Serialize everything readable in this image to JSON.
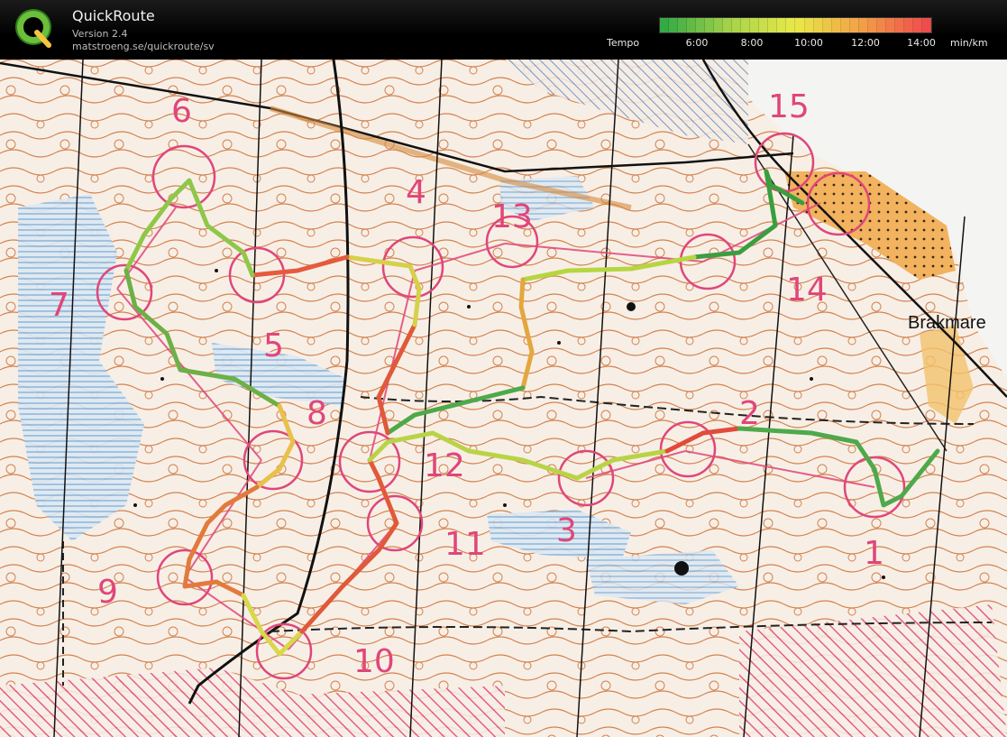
{
  "header": {
    "app_name": "QuickRoute",
    "version": "Version 2.4",
    "url": "matstroeng.se/quickroute/sv",
    "logo_letter": "Q"
  },
  "legend": {
    "title": "Tempo",
    "ticks": [
      "6:00",
      "8:00",
      "10:00",
      "12:00",
      "14:00"
    ],
    "unit": "min/km",
    "gradient_colors": [
      "#33aa44",
      "#a6d24a",
      "#e9e94a",
      "#f2a047",
      "#ee4c4c"
    ]
  },
  "map": {
    "place_label": "Brakmare",
    "control_numbers": [
      "1",
      "2",
      "3",
      "4",
      "5",
      "6",
      "7",
      "8",
      "9",
      "10",
      "11",
      "12",
      "13",
      "14",
      "15"
    ],
    "colors": {
      "paper": "#f7efe6",
      "contour": "#d4824e",
      "water": "#6ba0cf",
      "control": "#e0467a",
      "path": "#111111",
      "yellow_field": "#f0b55a"
    }
  }
}
